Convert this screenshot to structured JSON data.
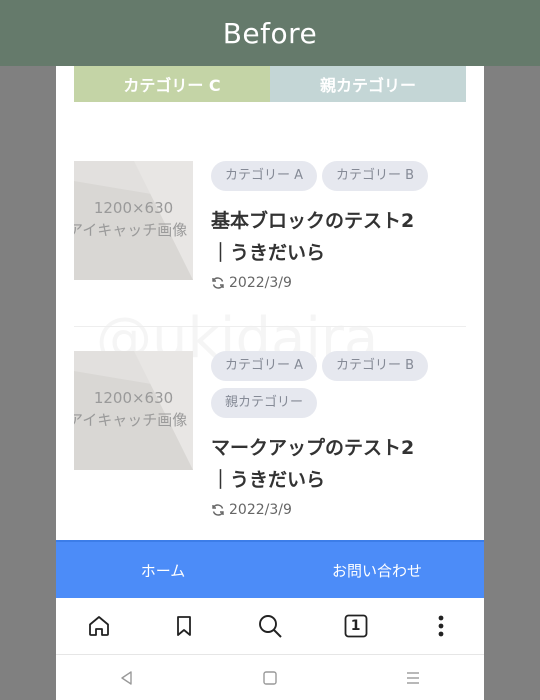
{
  "banner": {
    "label": "Before"
  },
  "category_bar": {
    "items": [
      "カテゴリー C",
      "親カテゴリー"
    ]
  },
  "posts": [
    {
      "thumb_line1": "1200×630",
      "thumb_line2": "アイキャッチ画像",
      "tags": [
        "カテゴリー A",
        "カテゴリー B"
      ],
      "title": "基本ブロックのテスト2｜うきだいら",
      "date": "2022/3/9"
    },
    {
      "thumb_line1": "1200×630",
      "thumb_line2": "アイキャッチ画像",
      "tags": [
        "カテゴリー A",
        "カテゴリー B",
        "親カテゴリー"
      ],
      "title": "マークアップのテスト2｜うきだいら",
      "date": "2022/3/9"
    }
  ],
  "watermark": "@ukidaira",
  "bottom_nav": {
    "home": "ホーム",
    "contact": "お問い合わせ"
  },
  "toolbar": {
    "icons": [
      "home-icon",
      "bookmark-icon",
      "search-icon",
      "tabs-icon",
      "more-icon"
    ],
    "tab_count": "1"
  },
  "system_nav": {
    "icons": [
      "back-icon",
      "home-square-icon",
      "menu-icon"
    ]
  }
}
